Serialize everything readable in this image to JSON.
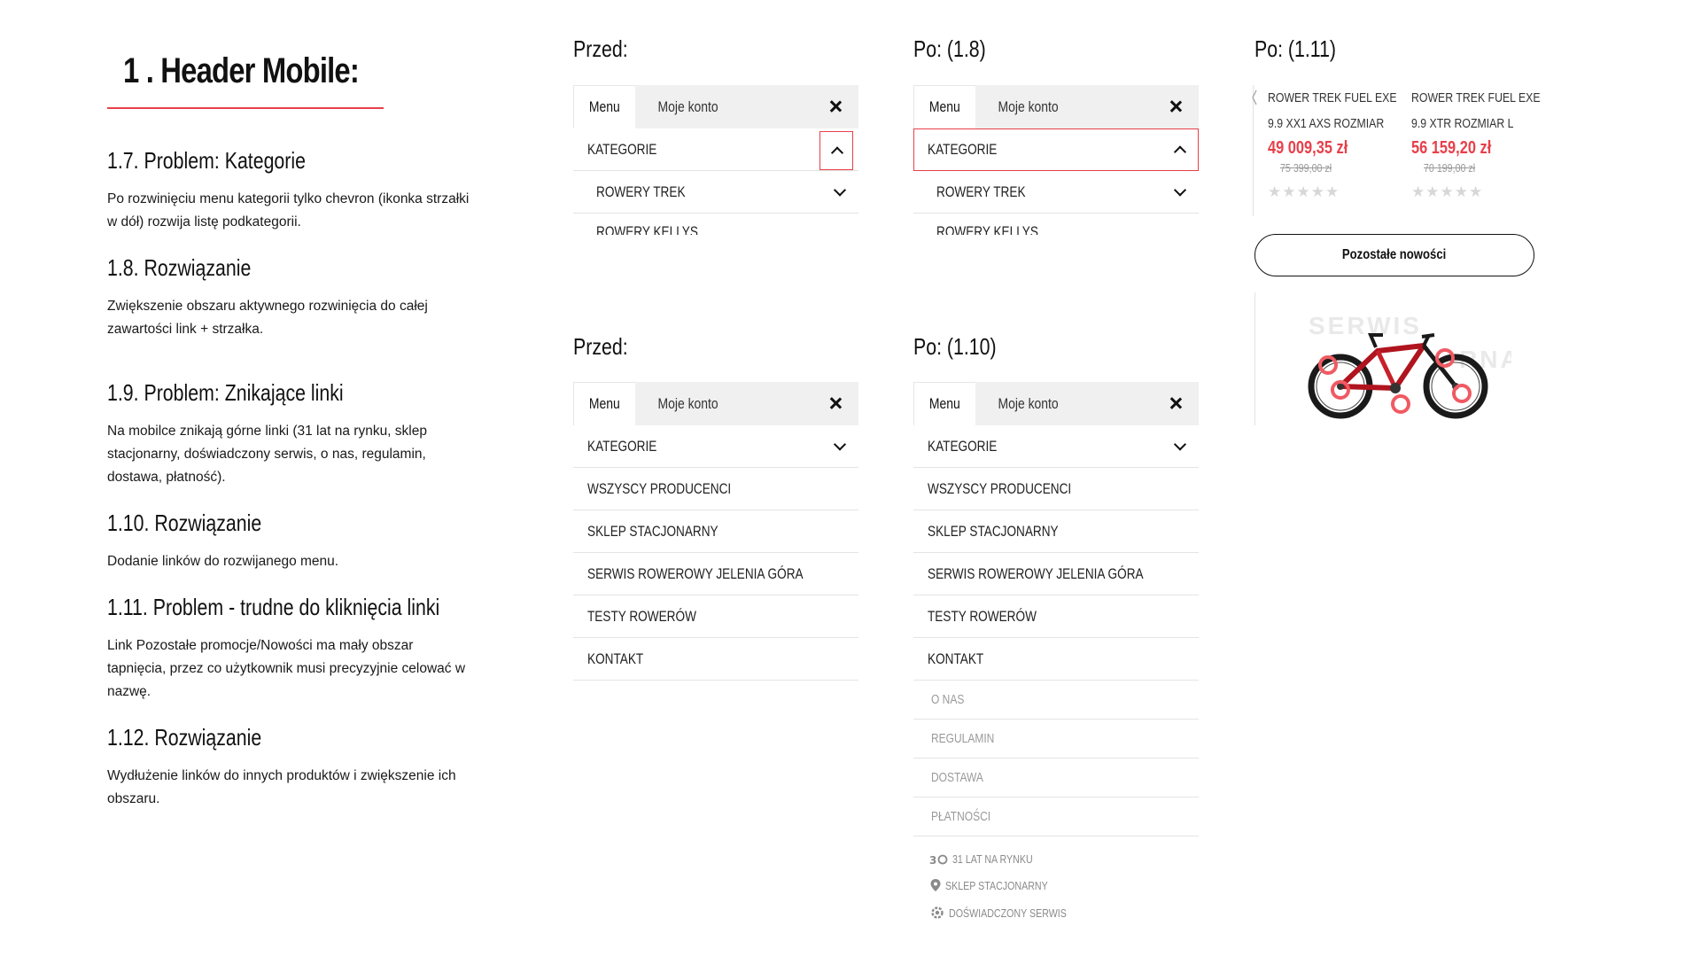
{
  "left": {
    "main_title": "1 .  Header Mobile:",
    "sections": [
      {
        "heading": "1.7. Problem: Kategorie",
        "text": "Po rozwinięciu menu kategorii tylko chevron (ikonka strzałki w dół) rozwija listę podkategorii."
      },
      {
        "heading": "1.8. Rozwiązanie",
        "text": "Zwiększenie obszaru aktywnego rozwinięcia do całej zawartości link + strzałka."
      },
      {
        "heading": "1.9. Problem: Znikające linki",
        "text": "Na mobilce znikają górne linki (31 lat na rynku, sklep stacjonarny, doświadczony serwis, o nas, regulamin, dostawa, płatność)."
      },
      {
        "heading": "1.10. Rozwiązanie",
        "text": "Dodanie linków do rozwijanego menu."
      },
      {
        "heading": "1.11. Problem - trudne do kliknięcia linki",
        "text": "Link Pozostałe promocje/Nowości ma mały obszar tapnięcia, przez co użytkownik musi precyzyjnie celować w nazwę."
      },
      {
        "heading": "1.12. Rozwiązanie",
        "text": "Wydłużenie linków do innych produktów i zwiększenie ich obszaru."
      }
    ]
  },
  "labels": {
    "before_top": "Przed:",
    "after_18": "Po: (1.8)",
    "after_111": "Po: (1.11)",
    "before_bottom": "Przed:",
    "after_110": "Po: (1.10)"
  },
  "menu": {
    "tab_menu": "Menu",
    "tab_account": "Moje konto",
    "kategorie": "KATEGORIE",
    "sub_items": [
      "ROWERY TREK",
      "ROWERY KELLYS"
    ],
    "links": [
      "WSZYSCY PRODUCENCI",
      "SKLEP STACJONARNY",
      "SERWIS ROWEROWY JELENIA GÓRA",
      "TESTY ROWERÓW",
      "KONTAKT"
    ],
    "extra_links": [
      "O NAS",
      "REGULAMIN",
      "DOSTAWA",
      "PŁATNOŚCI"
    ],
    "footer": [
      "31 LAT NA RYNKU",
      "SKLEP STACJONARNY",
      "DOŚWIADCZONY SERWIS"
    ]
  },
  "products": [
    {
      "name1": "ROWER TREK FUEL EXE",
      "name2": "9.9 XX1 AXS ROZMIAR",
      "price": "49 009,35 zł",
      "old_price": "75 399,00 zł",
      "stars": "★★★★★"
    },
    {
      "name1": "ROWER TREK FUEL EXE",
      "name2": "9.9 XTR ROZMIAR L",
      "price": "56 159,20 zł",
      "old_price": "70 199,00 zł",
      "stars": "★★★★★"
    }
  ],
  "more_button": "Pozostałe nowości",
  "banner": {
    "word1": "SERWIS",
    "word2": "RNA"
  },
  "colors": {
    "accent": "#e8404a",
    "tab_bg": "#f0f0f0",
    "divider": "#e4e4e4"
  }
}
